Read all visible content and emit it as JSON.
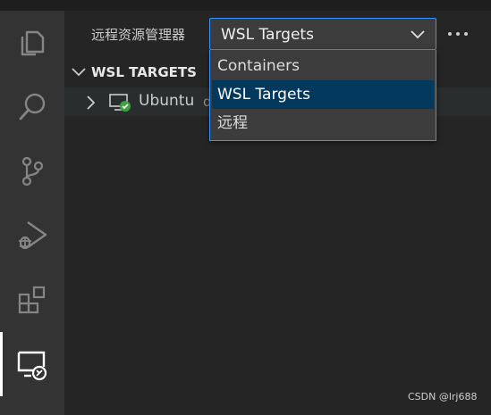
{
  "activity_bar": {
    "items": [
      {
        "name": "explorer",
        "icon": "files-icon",
        "active": false
      },
      {
        "name": "search",
        "icon": "search-icon",
        "active": false
      },
      {
        "name": "source-control",
        "icon": "source-control-icon",
        "active": false
      },
      {
        "name": "run-and-debug",
        "icon": "run-debug-icon",
        "active": false
      },
      {
        "name": "extensions",
        "icon": "extensions-icon",
        "active": false
      },
      {
        "name": "remote-explorer",
        "icon": "remote-explorer-icon",
        "active": true
      }
    ]
  },
  "sidebar": {
    "title": "远程资源管理器",
    "select": {
      "value": "WSL Targets",
      "options": [
        "Containers",
        "WSL Targets",
        "远程"
      ],
      "selected_index": 1
    },
    "more_actions_icon": "ellipsis-icon",
    "section": {
      "title": "WSL TARGETS"
    },
    "tree": [
      {
        "label": "Ubuntu",
        "description": "d",
        "icon": "monitor-connected-icon",
        "status_color": "#3fa142"
      }
    ]
  },
  "watermark": "CSDN @lrj688",
  "colors": {
    "accent_border": "#3794ff",
    "selection": "#04395e",
    "activity_bar": "#333333",
    "sidebar": "#252526"
  }
}
